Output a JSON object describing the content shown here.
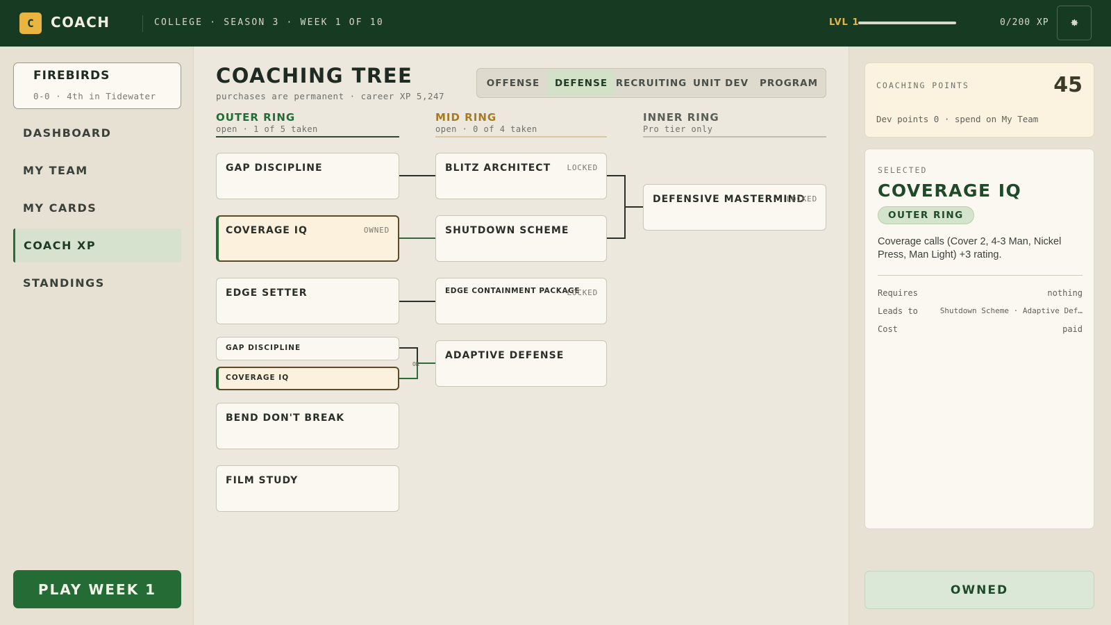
{
  "topbar": {
    "logo_letter": "C",
    "app_title": "COACH",
    "season_info": "COLLEGE · SEASON 3 · WEEK 1 OF 10",
    "level_label": "LVL 1",
    "xp_progress": 0,
    "xp_text": "0/200 XP",
    "settings_icon": "gear-icon"
  },
  "sidebar": {
    "team_name": "FIREBIRDS",
    "team_record": "0-0 · 4th in Tidewater",
    "nav": [
      {
        "label": "DASHBOARD"
      },
      {
        "label": "MY TEAM"
      },
      {
        "label": "MY CARDS"
      },
      {
        "label": "COACH XP",
        "active": true
      },
      {
        "label": "STANDINGS"
      }
    ],
    "play_button": "PLAY WEEK 1"
  },
  "main": {
    "title": "COACHING TREE",
    "subtitle": "purchases are permanent · career XP 5,247",
    "tabs": [
      {
        "label": "OFFENSE"
      },
      {
        "label": "DEFENSE",
        "active": true
      },
      {
        "label": "RECRUITING"
      },
      {
        "label": "UNIT DEV"
      },
      {
        "label": "PROGRAM"
      }
    ],
    "rings": {
      "outer": {
        "title": "OUTER RING",
        "sub": "open · 1 of 5 taken"
      },
      "mid": {
        "title": "MID RING",
        "sub": "open · 0 of 4 taken"
      },
      "inner": {
        "title": "INNER RING",
        "sub": "Pro tier only"
      }
    },
    "outer_nodes": [
      {
        "label": "GAP DISCIPLINE",
        "tag": ""
      },
      {
        "label": "COVERAGE IQ",
        "tag": "OWNED"
      },
      {
        "label": "EDGE SETTER",
        "tag": ""
      },
      {
        "label": "GAP DISCIPLINE",
        "tag": ""
      },
      {
        "label": "COVERAGE IQ",
        "tag": ""
      },
      {
        "label": "BEND DON'T BREAK",
        "tag": ""
      },
      {
        "label": "FILM STUDY",
        "tag": ""
      }
    ],
    "mid_nodes": [
      {
        "label": "BLITZ ARCHITECT",
        "tag": "LOCKED"
      },
      {
        "label": "SHUTDOWN SCHEME",
        "tag": ""
      },
      {
        "label": "EDGE CONTAINMENT PACKAGE",
        "tag": "LOCKED"
      },
      {
        "label": "ADAPTIVE DEFENSE",
        "tag": ""
      }
    ],
    "inner_nodes": [
      {
        "label": "DEFENSIVE MASTERMIND",
        "tag": "LOCKED"
      }
    ],
    "or_label": "OR"
  },
  "right": {
    "points_label": "COACHING POINTS",
    "points_value": "45",
    "points_sub": "Dev points 0  · spend on My Team",
    "selected_label": "SELECTED",
    "selected_title": "COVERAGE IQ",
    "selected_ring": "OUTER RING",
    "selected_desc": "Coverage calls (Cover 2, 4-3 Man, Nickel Press, Man Light) +3 rating.",
    "requires_label": "Requires",
    "requires_value": "nothing",
    "leads_label": "Leads to",
    "leads_value": "Shutdown Scheme · Adaptive Def…",
    "cost_label": "Cost",
    "cost_value": "paid",
    "action_button": "OWNED"
  },
  "colors": {
    "topbar": "#173a22",
    "accent_green": "#256b35",
    "accent_gold": "#e9b440",
    "background": "#ece8dd"
  }
}
